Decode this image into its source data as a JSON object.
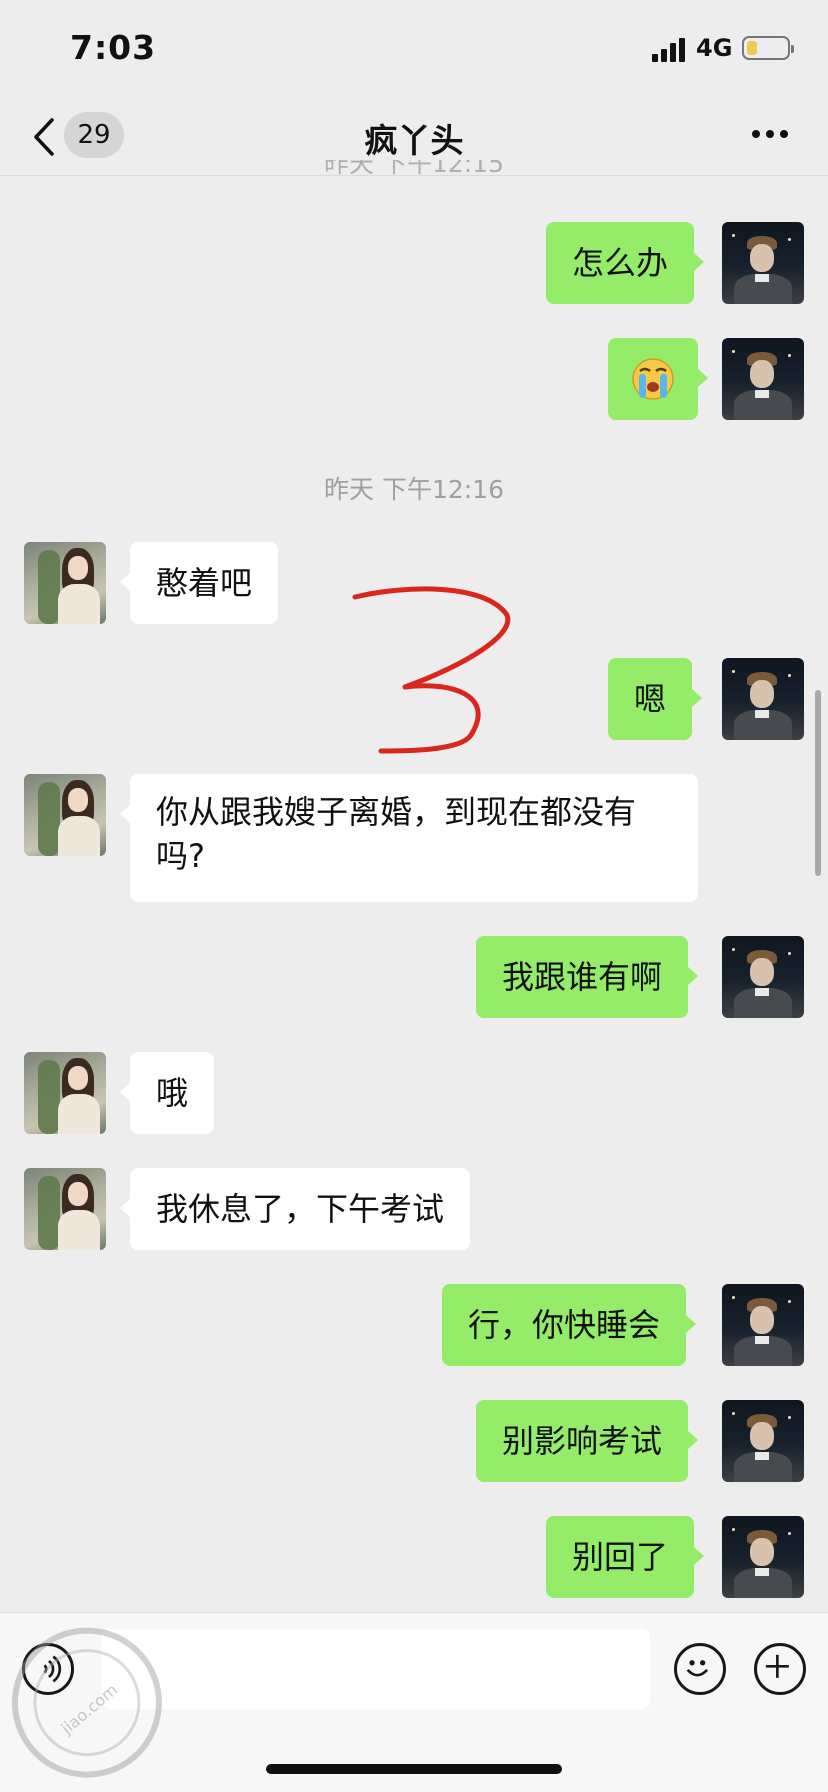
{
  "status_bar": {
    "time": "7:03",
    "network": "4G"
  },
  "nav": {
    "unread_count": "29",
    "title": "疯丫头"
  },
  "messages": {
    "timestamp_top_partial": "昨天 下午12:15",
    "m1": "怎么办",
    "timestamp": "昨天 下午12:16",
    "m3": "憨着吧",
    "m4": "嗯",
    "m5": "你从跟我嫂子离婚，到现在都没有吗?",
    "m6": "我跟谁有啊",
    "m7": "哦",
    "m8": "我休息了，下午考试",
    "m9": "行，你快睡会",
    "m10": "别影响考试",
    "m11": "别回了"
  },
  "annotation": {
    "handwritten_mark": "3",
    "color": "#d9271c"
  },
  "colors": {
    "my_bubble": "#95ec69",
    "their_bubble": "#ffffff",
    "background": "#ededed"
  },
  "watermark": {
    "text": "jiao.com"
  },
  "icons": {
    "back": "chevron-left-icon",
    "more": "more-dots-icon",
    "voice": "voice-icon",
    "emoji": "emoji-icon",
    "plus": "plus-icon",
    "crying_emoji": "crying-face-icon"
  }
}
